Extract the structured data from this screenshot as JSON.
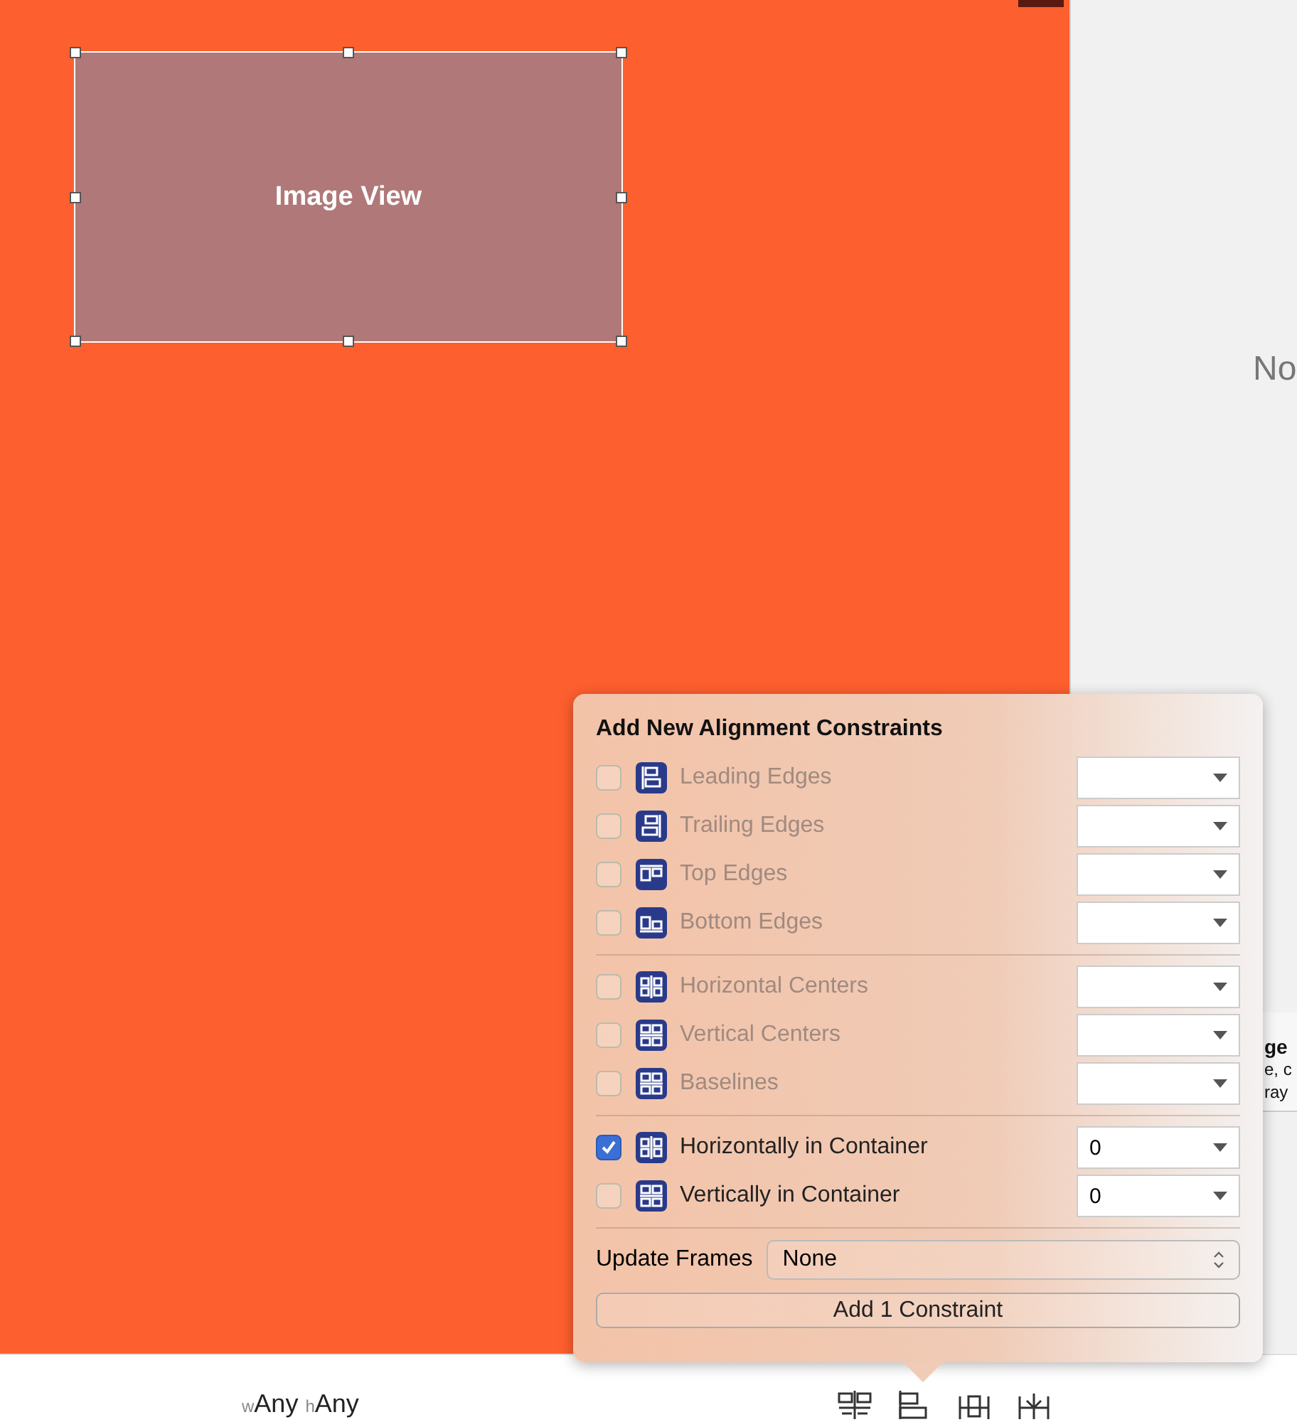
{
  "canvas": {
    "image_view": {
      "label": "Image View"
    }
  },
  "inspector": {
    "placeholder_text": "No",
    "fragment_lines": [
      "ge",
      "e, c",
      "ray"
    ]
  },
  "size_class": {
    "width_prefix": "w",
    "width_value": "Any",
    "height_prefix": "h",
    "height_value": "Any"
  },
  "popover": {
    "title": "Add New Alignment Constraints",
    "groups": [
      [
        {
          "label": "Leading Edges",
          "checked": false,
          "disabled": true,
          "kind": "leading"
        },
        {
          "label": "Trailing Edges",
          "checked": false,
          "disabled": true,
          "kind": "trailing"
        },
        {
          "label": "Top Edges",
          "checked": false,
          "disabled": true,
          "kind": "top"
        },
        {
          "label": "Bottom Edges",
          "checked": false,
          "disabled": true,
          "kind": "bottom"
        }
      ],
      [
        {
          "label": "Horizontal Centers",
          "checked": false,
          "disabled": true,
          "kind": "hcenter"
        },
        {
          "label": "Vertical Centers",
          "checked": false,
          "disabled": true,
          "kind": "vcenter"
        },
        {
          "label": "Baselines",
          "checked": false,
          "disabled": true,
          "kind": "vcenter"
        }
      ],
      [
        {
          "label": "Horizontally in Container",
          "checked": true,
          "disabled": false,
          "kind": "hcenter",
          "value": "0"
        },
        {
          "label": "Vertically in Container",
          "checked": false,
          "disabled": false,
          "kind": "vcenter",
          "value": "0"
        }
      ]
    ],
    "update_frames": {
      "label": "Update Frames",
      "value": "None"
    },
    "add_button": "Add 1 Constraint"
  }
}
